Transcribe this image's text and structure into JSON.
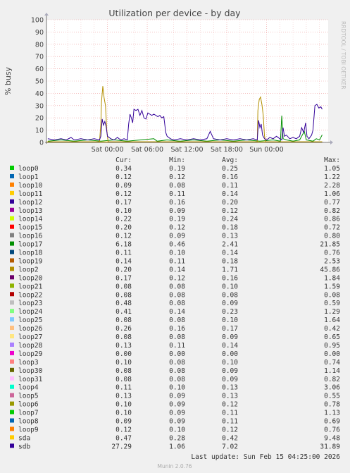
{
  "chart_data": {
    "type": "line",
    "title": "Utilization per device - by day",
    "ylabel": "% busy",
    "xlabel": "",
    "side_label": "RRDTOOL / TOBI OETIKER",
    "ylim": [
      0,
      100
    ],
    "y_ticks": [
      0,
      10,
      20,
      30,
      40,
      50,
      60,
      70,
      80,
      90,
      100
    ],
    "x_range_hours": [
      -9.2,
      33.3
    ],
    "x_ticks": [
      {
        "label": "Sat 00:00",
        "hour": 0
      },
      {
        "label": "Sat 06:00",
        "hour": 6
      },
      {
        "label": "Sat 12:00",
        "hour": 12
      },
      {
        "label": "Sat 18:00",
        "hour": 18
      },
      {
        "label": "Sun 00:00",
        "hour": 24
      }
    ],
    "grid": true,
    "legend_headers": {
      "cur": "Cur:",
      "min": "Min:",
      "avg": "Avg:",
      "max": "Max:"
    },
    "series": [
      {
        "name": "loop0",
        "color": "#00cc00",
        "cur": "0.34",
        "min": "0.19",
        "avg": "0.25",
        "max": "1.05"
      },
      {
        "name": "loop1",
        "color": "#0066b3",
        "cur": "0.12",
        "min": "0.12",
        "avg": "0.16",
        "max": "1.22"
      },
      {
        "name": "loop10",
        "color": "#ff8000",
        "cur": "0.09",
        "min": "0.08",
        "avg": "0.11",
        "max": "2.28"
      },
      {
        "name": "loop11",
        "color": "#ffcc00",
        "cur": "0.12",
        "min": "0.11",
        "avg": "0.14",
        "max": "1.06"
      },
      {
        "name": "loop12",
        "color": "#330099",
        "cur": "0.17",
        "min": "0.16",
        "avg": "0.20",
        "max": "0.77"
      },
      {
        "name": "loop13",
        "color": "#990099",
        "cur": "0.10",
        "min": "0.09",
        "avg": "0.12",
        "max": "0.82"
      },
      {
        "name": "loop14",
        "color": "#ccff00",
        "cur": "0.22",
        "min": "0.19",
        "avg": "0.24",
        "max": "0.86"
      },
      {
        "name": "loop15",
        "color": "#ff0000",
        "cur": "0.20",
        "min": "0.12",
        "avg": "0.18",
        "max": "0.72"
      },
      {
        "name": "loop16",
        "color": "#808080",
        "cur": "0.12",
        "min": "0.09",
        "avg": "0.13",
        "max": "0.80"
      },
      {
        "name": "loop17",
        "color": "#008f00",
        "cur": "6.18",
        "min": "0.46",
        "avg": "2.41",
        "max": "21.85"
      },
      {
        "name": "loop18",
        "color": "#00487d",
        "cur": "0.11",
        "min": "0.10",
        "avg": "0.14",
        "max": "0.76"
      },
      {
        "name": "loop19",
        "color": "#b35a00",
        "cur": "0.14",
        "min": "0.11",
        "avg": "0.18",
        "max": "2.53"
      },
      {
        "name": "loop2",
        "color": "#b38f00",
        "cur": "0.20",
        "min": "0.14",
        "avg": "1.71",
        "max": "45.86"
      },
      {
        "name": "loop20",
        "color": "#6b006b",
        "cur": "0.17",
        "min": "0.12",
        "avg": "0.16",
        "max": "1.84"
      },
      {
        "name": "loop21",
        "color": "#8fb300",
        "cur": "0.08",
        "min": "0.08",
        "avg": "0.10",
        "max": "1.59"
      },
      {
        "name": "loop22",
        "color": "#b30000",
        "cur": "0.08",
        "min": "0.08",
        "avg": "0.08",
        "max": "0.08"
      },
      {
        "name": "loop23",
        "color": "#bebebe",
        "cur": "0.48",
        "min": "0.08",
        "avg": "0.09",
        "max": "0.59"
      },
      {
        "name": "loop24",
        "color": "#80ff80",
        "cur": "0.41",
        "min": "0.14",
        "avg": "0.23",
        "max": "1.29"
      },
      {
        "name": "loop25",
        "color": "#80c9ff",
        "cur": "0.08",
        "min": "0.08",
        "avg": "0.10",
        "max": "1.64"
      },
      {
        "name": "loop26",
        "color": "#ffc080",
        "cur": "0.26",
        "min": "0.16",
        "avg": "0.17",
        "max": "0.42"
      },
      {
        "name": "loop27",
        "color": "#ffe680",
        "cur": "0.08",
        "min": "0.08",
        "avg": "0.09",
        "max": "0.65"
      },
      {
        "name": "loop28",
        "color": "#aa80ff",
        "cur": "0.13",
        "min": "0.11",
        "avg": "0.14",
        "max": "0.95"
      },
      {
        "name": "loop29",
        "color": "#ee00cc",
        "cur": "0.00",
        "min": "0.00",
        "avg": "0.00",
        "max": "0.00"
      },
      {
        "name": "loop3",
        "color": "#ff8080",
        "cur": "0.10",
        "min": "0.08",
        "avg": "0.10",
        "max": "0.74"
      },
      {
        "name": "loop30",
        "color": "#666600",
        "cur": "0.08",
        "min": "0.08",
        "avg": "0.09",
        "max": "1.14"
      },
      {
        "name": "loop31",
        "color": "#ffbfff",
        "cur": "0.08",
        "min": "0.08",
        "avg": "0.09",
        "max": "0.82"
      },
      {
        "name": "loop4",
        "color": "#00ffcc",
        "cur": "0.11",
        "min": "0.10",
        "avg": "0.13",
        "max": "3.06"
      },
      {
        "name": "loop5",
        "color": "#cc6699",
        "cur": "0.13",
        "min": "0.09",
        "avg": "0.13",
        "max": "0.55"
      },
      {
        "name": "loop6",
        "color": "#999900",
        "cur": "0.10",
        "min": "0.09",
        "avg": "0.12",
        "max": "0.78"
      },
      {
        "name": "loop7",
        "color": "#00cc00",
        "cur": "0.10",
        "min": "0.09",
        "avg": "0.11",
        "max": "1.13"
      },
      {
        "name": "loop8",
        "color": "#0066b3",
        "cur": "0.09",
        "min": "0.09",
        "avg": "0.11",
        "max": "0.69"
      },
      {
        "name": "loop9",
        "color": "#ff8000",
        "cur": "0.12",
        "min": "0.10",
        "avg": "0.12",
        "max": "0.76"
      },
      {
        "name": "sda",
        "color": "#ffcc00",
        "cur": "0.47",
        "min": "0.28",
        "avg": "0.42",
        "max": "9.48"
      },
      {
        "name": "sdb",
        "color": "#330099",
        "cur": "27.29",
        "min": "1.06",
        "avg": "7.02",
        "max": "31.89"
      }
    ],
    "trace_points": {
      "sdb": [
        [
          -9.0,
          3
        ],
        [
          -8.0,
          2
        ],
        [
          -7.0,
          3
        ],
        [
          -6.2,
          2
        ],
        [
          -5.5,
          4
        ],
        [
          -5.0,
          2
        ],
        [
          -4.0,
          3
        ],
        [
          -3.0,
          2
        ],
        [
          -2.0,
          3
        ],
        [
          -1.2,
          2
        ],
        [
          -1.0,
          5
        ],
        [
          -0.8,
          19
        ],
        [
          -0.6,
          14
        ],
        [
          -0.4,
          17
        ],
        [
          -0.2,
          13
        ],
        [
          0.0,
          5
        ],
        [
          0.5,
          3
        ],
        [
          1.0,
          2
        ],
        [
          1.5,
          4
        ],
        [
          2.0,
          2
        ],
        [
          2.5,
          3
        ],
        [
          3.0,
          2
        ],
        [
          3.2,
          15
        ],
        [
          3.4,
          23
        ],
        [
          3.6,
          20
        ],
        [
          3.8,
          16
        ],
        [
          4.0,
          27
        ],
        [
          4.3,
          26
        ],
        [
          4.6,
          27
        ],
        [
          4.9,
          22
        ],
        [
          5.2,
          26
        ],
        [
          5.5,
          20
        ],
        [
          5.8,
          19
        ],
        [
          6.1,
          24
        ],
        [
          6.4,
          23
        ],
        [
          6.7,
          22
        ],
        [
          7.0,
          23
        ],
        [
          7.3,
          22
        ],
        [
          7.6,
          21
        ],
        [
          7.9,
          22
        ],
        [
          8.2,
          20
        ],
        [
          8.5,
          21
        ],
        [
          8.8,
          8
        ],
        [
          9.0,
          5
        ],
        [
          9.5,
          3
        ],
        [
          10.0,
          2
        ],
        [
          11.0,
          3
        ],
        [
          12.0,
          2
        ],
        [
          13.0,
          3
        ],
        [
          14.0,
          2
        ],
        [
          15.0,
          3
        ],
        [
          15.5,
          9
        ],
        [
          16.0,
          3
        ],
        [
          17.0,
          2
        ],
        [
          18.0,
          3
        ],
        [
          19.0,
          2
        ],
        [
          20.0,
          3
        ],
        [
          21.0,
          2
        ],
        [
          22.0,
          3
        ],
        [
          22.6,
          2
        ],
        [
          22.8,
          18
        ],
        [
          23.0,
          12
        ],
        [
          23.2,
          15
        ],
        [
          23.4,
          6
        ],
        [
          23.7,
          3
        ],
        [
          24.0,
          2
        ],
        [
          24.5,
          4
        ],
        [
          25.0,
          3
        ],
        [
          25.5,
          5
        ],
        [
          26.0,
          3
        ],
        [
          26.3,
          2
        ],
        [
          26.5,
          12
        ],
        [
          26.7,
          5
        ],
        [
          27.0,
          6
        ],
        [
          27.5,
          3
        ],
        [
          28.0,
          4
        ],
        [
          28.5,
          3
        ],
        [
          29.0,
          5
        ],
        [
          29.3,
          12
        ],
        [
          29.6,
          8
        ],
        [
          29.9,
          16
        ],
        [
          30.1,
          5
        ],
        [
          30.4,
          3
        ],
        [
          30.8,
          6
        ],
        [
          31.0,
          10
        ],
        [
          31.3,
          30
        ],
        [
          31.6,
          31
        ],
        [
          31.9,
          28
        ],
        [
          32.2,
          29
        ],
        [
          32.4,
          27
        ]
      ],
      "loop2": [
        [
          -9.0,
          0.5
        ],
        [
          -2.0,
          0.5
        ],
        [
          -1.2,
          0.5
        ],
        [
          -1.0,
          15
        ],
        [
          -0.9,
          33
        ],
        [
          -0.7,
          45.86
        ],
        [
          -0.5,
          36
        ],
        [
          -0.3,
          30
        ],
        [
          -0.1,
          10
        ],
        [
          0.1,
          0.5
        ],
        [
          20.0,
          0.5
        ],
        [
          22.6,
          0.5
        ],
        [
          22.7,
          26
        ],
        [
          22.9,
          35
        ],
        [
          23.1,
          37
        ],
        [
          23.3,
          31
        ],
        [
          23.5,
          22
        ],
        [
          23.7,
          5
        ],
        [
          23.9,
          0.5
        ],
        [
          32.4,
          0.5
        ]
      ],
      "loop17": [
        [
          -9.0,
          1
        ],
        [
          -7.0,
          2
        ],
        [
          -5.0,
          1
        ],
        [
          -3.0,
          2
        ],
        [
          -1.0,
          1
        ],
        [
          1.0,
          2
        ],
        [
          3.0,
          1
        ],
        [
          5.0,
          2
        ],
        [
          7.0,
          3
        ],
        [
          7.5,
          1
        ],
        [
          9.0,
          2
        ],
        [
          11.0,
          1
        ],
        [
          13.0,
          2
        ],
        [
          15.0,
          1
        ],
        [
          17.0,
          2
        ],
        [
          19.0,
          1
        ],
        [
          21.0,
          2
        ],
        [
          23.0,
          1
        ],
        [
          25.0,
          2
        ],
        [
          26.1,
          1
        ],
        [
          26.3,
          21.85
        ],
        [
          26.5,
          3
        ],
        [
          27.0,
          2
        ],
        [
          28.0,
          1
        ],
        [
          29.0,
          2
        ],
        [
          29.7,
          9
        ],
        [
          30.0,
          2
        ],
        [
          31.0,
          1
        ],
        [
          31.5,
          3
        ],
        [
          32.0,
          2
        ],
        [
          32.4,
          6.18
        ]
      ]
    },
    "footer_update": "Last update: Sun Feb 15 04:25:00 2026",
    "footer_version": "Munin 2.0.76"
  }
}
